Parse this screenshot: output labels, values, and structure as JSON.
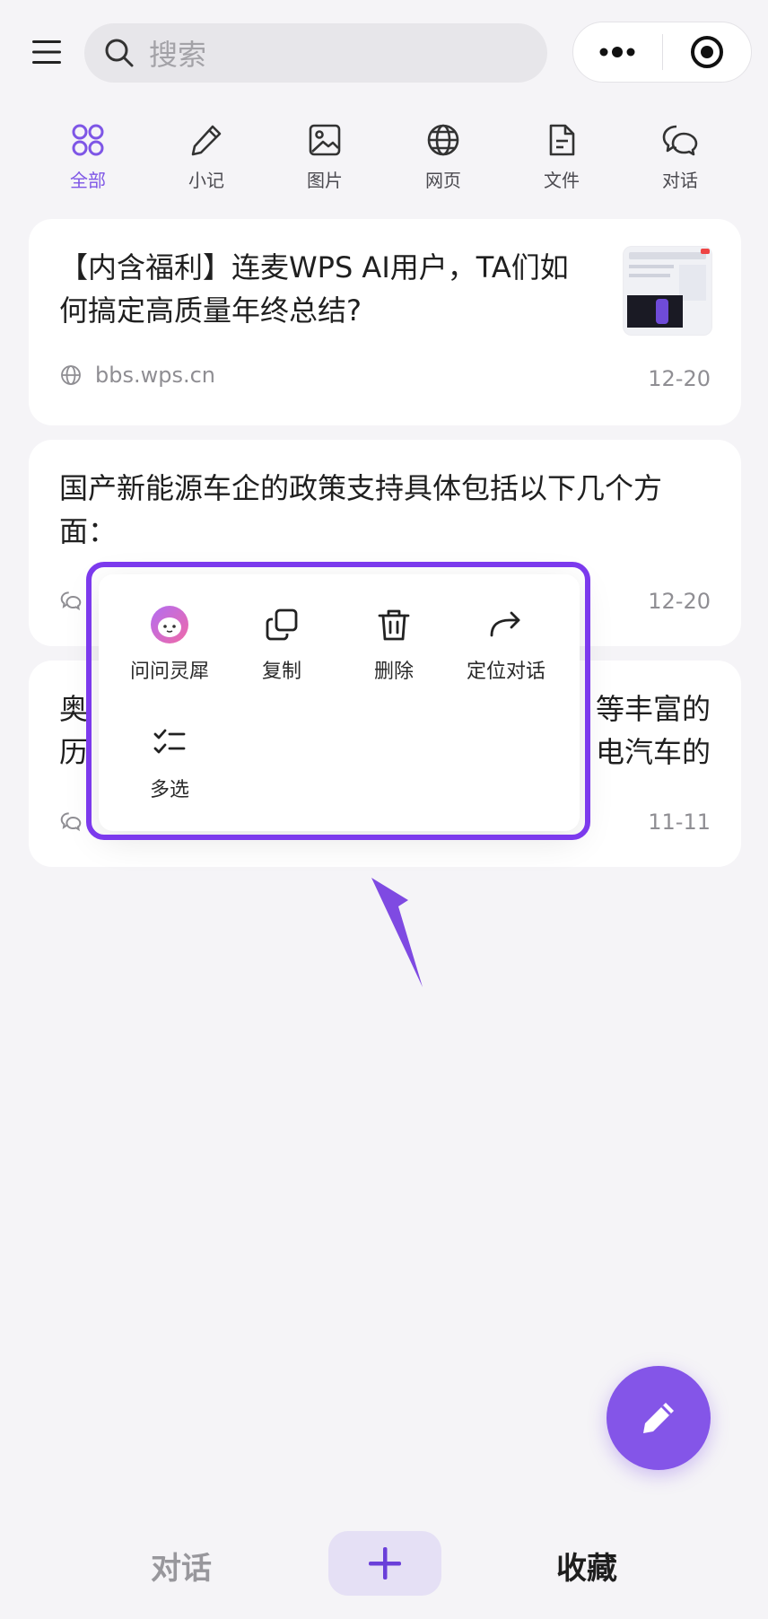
{
  "search": {
    "placeholder": "搜索"
  },
  "tabs": [
    {
      "label": "全部",
      "icon": "grid-icon",
      "active": true
    },
    {
      "label": "小记",
      "icon": "pencil-icon"
    },
    {
      "label": "图片",
      "icon": "image-icon"
    },
    {
      "label": "网页",
      "icon": "globe-icon"
    },
    {
      "label": "文件",
      "icon": "file-icon"
    },
    {
      "label": "对话",
      "icon": "chat-icon"
    }
  ],
  "cards": [
    {
      "title_line1": "【内含福利】连麦WPS AI用户，TA们如",
      "title_line2": "何搞定高质量年终总结?",
      "source": "bbs.wps.cn",
      "date": "12-20"
    },
    {
      "title_line1": "国产新能源车企的政策支持具体包括以下几个方",
      "title_line2": "面：",
      "date": "12-20"
    },
    {
      "title_left1": "奥",
      "title_right1": "等丰富的",
      "title_left2": "历",
      "title_right2": "电汽车的",
      "date": "11-11"
    }
  ],
  "popover": {
    "actions": [
      {
        "label": "问问灵犀",
        "icon": "assistant-icon"
      },
      {
        "label": "复制",
        "icon": "copy-icon"
      },
      {
        "label": "删除",
        "icon": "trash-icon"
      },
      {
        "label": "定位对话",
        "icon": "forward-arrow-icon"
      },
      {
        "label": "多选",
        "icon": "checklist-icon"
      }
    ]
  },
  "bottom_nav": {
    "left": "对话",
    "right": "收藏"
  },
  "colors": {
    "accent": "#7e56e6",
    "highlight_frame": "#7c3aed",
    "fab": "#8455e8"
  }
}
